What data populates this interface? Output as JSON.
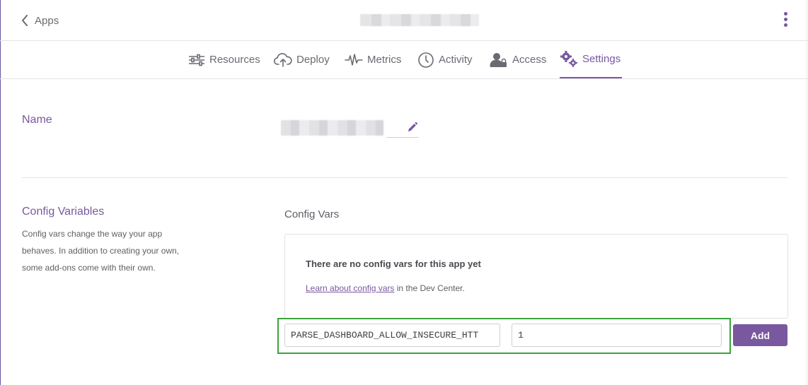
{
  "header": {
    "back_label": "Apps"
  },
  "tabs": [
    {
      "label": "Resources",
      "icon": "sliders-icon",
      "active": false
    },
    {
      "label": "Deploy",
      "icon": "cloud-upload-icon",
      "active": false
    },
    {
      "label": "Metrics",
      "icon": "pulse-icon",
      "active": false
    },
    {
      "label": "Activity",
      "icon": "clock-icon",
      "active": false
    },
    {
      "label": "Access",
      "icon": "user-lock-icon",
      "active": false
    },
    {
      "label": "Settings",
      "icon": "gears-icon",
      "active": true
    }
  ],
  "name_section": {
    "title": "Name"
  },
  "config_section": {
    "title": "Config Variables",
    "description": "Config vars change the way your app behaves. In addition to creating your own, some add-ons come with their own.",
    "vars_heading": "Config Vars",
    "empty_title": "There are no config vars for this app yet",
    "empty_link": "Learn about config vars",
    "empty_suffix": " in the Dev Center.",
    "key_value": "PARSE_DASHBOARD_ALLOW_INSECURE_HTT",
    "value_value": "1",
    "add_label": "Add"
  },
  "colors": {
    "accent": "#79589f",
    "highlight": "#3da23d"
  }
}
